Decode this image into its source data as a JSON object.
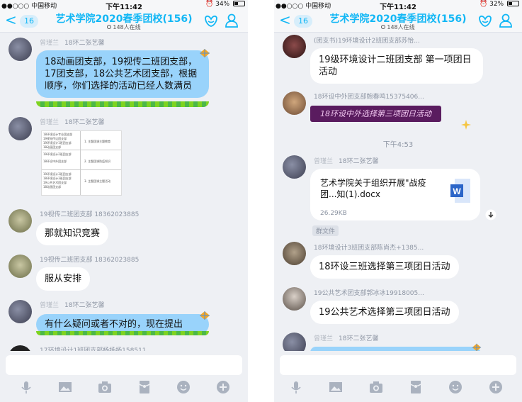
{
  "left": {
    "status": {
      "carrier": "●●○○○ 中国移动",
      "time": "下午11:42",
      "battery": "34%"
    },
    "nav": {
      "back": "<",
      "unread": "16",
      "title": "艺术学院2020春季团校(156)",
      "online": "148人在线"
    },
    "messages": [
      {
        "sender_blur": "曾瑾兰",
        "sender": "18环二张艺馨",
        "text": "18动画团支部，19视传二班团支部，17团支部，18公共艺术团支部，根据顺序，你们选择的活动已经人数满员",
        "style": "blue"
      },
      {
        "sender_blur": "曾瑾兰",
        "sender": "18环二张艺馨",
        "doc_rows": [
          "18环境设计专业团支部",
          "19视觉传达团支部",
          "19环境设计1班团支部",
          "18动画团支部",
          "19环境设计2班团支部",
          "18环设中外团支部",
          "19环境设计3班团支部",
          "18环境设计3班团支部",
          "19公共艺术团支部",
          "18动画团支部"
        ],
        "doc_items": [
          "1. 主题团课主题教育",
          "2. 主题团课防疫知识",
          "3. 主题团课主题活动"
        ]
      },
      {
        "sender": "19视传二班团支部 18362023885",
        "text": "那就知识竞赛",
        "style": "white"
      },
      {
        "sender": "19视传二班团支部 18362023885",
        "text": "服从安排",
        "style": "white"
      },
      {
        "sender_blur": "曾瑾兰",
        "sender": "18环二张艺馨",
        "text": "有什么疑问或者不对的，现在提出",
        "style": "blue"
      },
      {
        "sender": "17环境设计1班团支部杨扬扬158511"
      }
    ]
  },
  "right": {
    "status": {
      "carrier": "●●○○○ 中国移动",
      "time": "下午11:42",
      "battery": "32%"
    },
    "nav": {
      "back": "<",
      "unread": "16",
      "title": "艺术学院2020春季团校(156)",
      "online": "148人在线"
    },
    "messages": [
      {
        "sender": "(团支书)19环境设计2班团支部苏怡...",
        "text": "19级环境设计二班团支部 第一项团日活动",
        "style": "white"
      },
      {
        "sender": "18环设中外团支部鲍春鸣15375406...",
        "text": "18环设中外选择第三项团日活动",
        "style": "purple"
      },
      {
        "time_sep": "下午4:53"
      },
      {
        "sender_blur": "曾瑾兰",
        "sender": "18环二张艺馨",
        "file_name": "艺术学院关于组织开展\"战疫团...知(1).docx",
        "file_size": "26.29KB",
        "tag": "群文件"
      },
      {
        "sender": "18环境设计3班团支部陈尚杰+1385...",
        "text": "18环设三班选择第三项团日活动",
        "style": "white"
      },
      {
        "sender": "19公共艺术团支部郭冰冰19918005...",
        "text": "19公共艺术选择第三项团日活动",
        "style": "white"
      },
      {
        "sender_blur": "曾瑾兰",
        "sender": "18环二张艺馨"
      }
    ]
  },
  "toolbar_icons": [
    "microphone-icon",
    "image-icon",
    "camera-icon",
    "red-packet-icon",
    "emoji-icon",
    "plus-icon"
  ],
  "colors": {
    "accent": "#12b7f5",
    "bubble_blue": "#99d3fb",
    "background": "#eef0f4"
  }
}
